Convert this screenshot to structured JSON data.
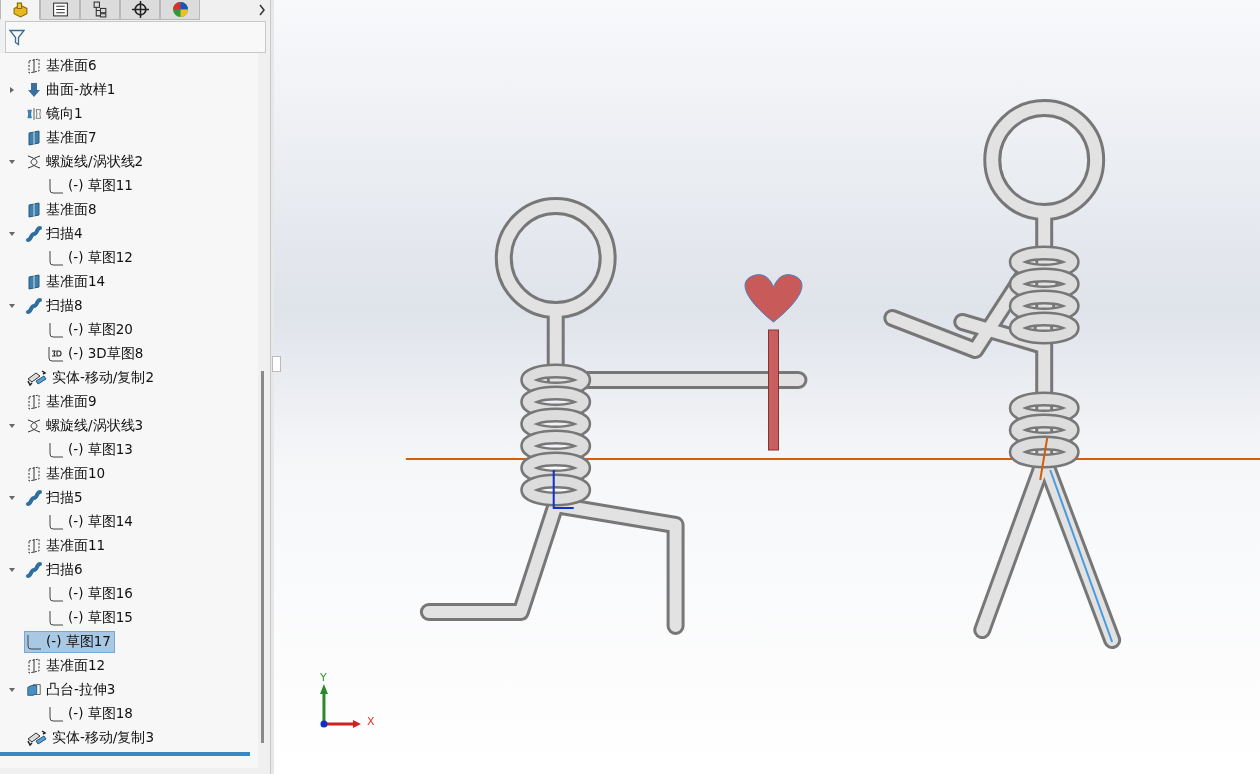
{
  "panel_tabs": [
    {
      "kind": "part",
      "selected": true
    },
    {
      "kind": "properties",
      "selected": false
    },
    {
      "kind": "config",
      "selected": false
    },
    {
      "kind": "target",
      "selected": false
    },
    {
      "kind": "appearance",
      "selected": false
    }
  ],
  "feature_tree": [
    {
      "label": "基准面6",
      "kind": "plane",
      "selected": false
    },
    {
      "label": "曲面-放样1",
      "kind": "loft",
      "expanded": false,
      "selected": false
    },
    {
      "label": "镜向1",
      "kind": "mirror",
      "selected": false
    },
    {
      "label": "基准面7",
      "kind": "plane_solid",
      "selected": false
    },
    {
      "label": "螺旋线/涡状线2",
      "kind": "helix",
      "expanded": true,
      "selected": false,
      "children": [
        {
          "label": "(-) 草图11",
          "kind": "sketch",
          "selected": false
        }
      ]
    },
    {
      "label": "基准面8",
      "kind": "plane_solid",
      "selected": false
    },
    {
      "label": "扫描4",
      "kind": "sweep",
      "expanded": true,
      "selected": false,
      "children": [
        {
          "label": "(-) 草图12",
          "kind": "sketch",
          "selected": false
        }
      ]
    },
    {
      "label": "基准面14",
      "kind": "plane_solid",
      "selected": false
    },
    {
      "label": "扫描8",
      "kind": "sweep",
      "expanded": true,
      "selected": false,
      "children": [
        {
          "label": "(-) 草图20",
          "kind": "sketch",
          "selected": false
        },
        {
          "label": "(-) 3D草图8",
          "kind": "sketch3d",
          "selected": false
        }
      ]
    },
    {
      "label": "实体-移动/复制2",
      "kind": "move",
      "selected": false
    },
    {
      "label": "基准面9",
      "kind": "plane",
      "selected": false
    },
    {
      "label": "螺旋线/涡状线3",
      "kind": "helix",
      "expanded": true,
      "selected": false,
      "children": [
        {
          "label": "(-) 草图13",
          "kind": "sketch",
          "selected": false
        }
      ]
    },
    {
      "label": "基准面10",
      "kind": "plane",
      "selected": false
    },
    {
      "label": "扫描5",
      "kind": "sweep",
      "expanded": true,
      "selected": false,
      "children": [
        {
          "label": "(-) 草图14",
          "kind": "sketch",
          "selected": false
        }
      ]
    },
    {
      "label": "基准面11",
      "kind": "plane",
      "selected": false
    },
    {
      "label": "扫描6",
      "kind": "sweep",
      "expanded": true,
      "selected": false,
      "children": [
        {
          "label": "(-) 草图16",
          "kind": "sketch",
          "selected": false
        },
        {
          "label": "(-) 草图15",
          "kind": "sketch",
          "selected": false
        }
      ]
    },
    {
      "label": "(-) 草图17",
      "kind": "sketch",
      "selected": true
    },
    {
      "label": "基准面12",
      "kind": "plane",
      "selected": false
    },
    {
      "label": "凸台-拉伸3",
      "kind": "extrude",
      "expanded": true,
      "selected": false,
      "children": [
        {
          "label": "(-) 草图18",
          "kind": "sketch",
          "selected": false
        }
      ]
    },
    {
      "label": "实体-移动/复制3",
      "kind": "move",
      "selected": false
    }
  ],
  "triad": {
    "y_label": "Y",
    "x_label": "X"
  }
}
